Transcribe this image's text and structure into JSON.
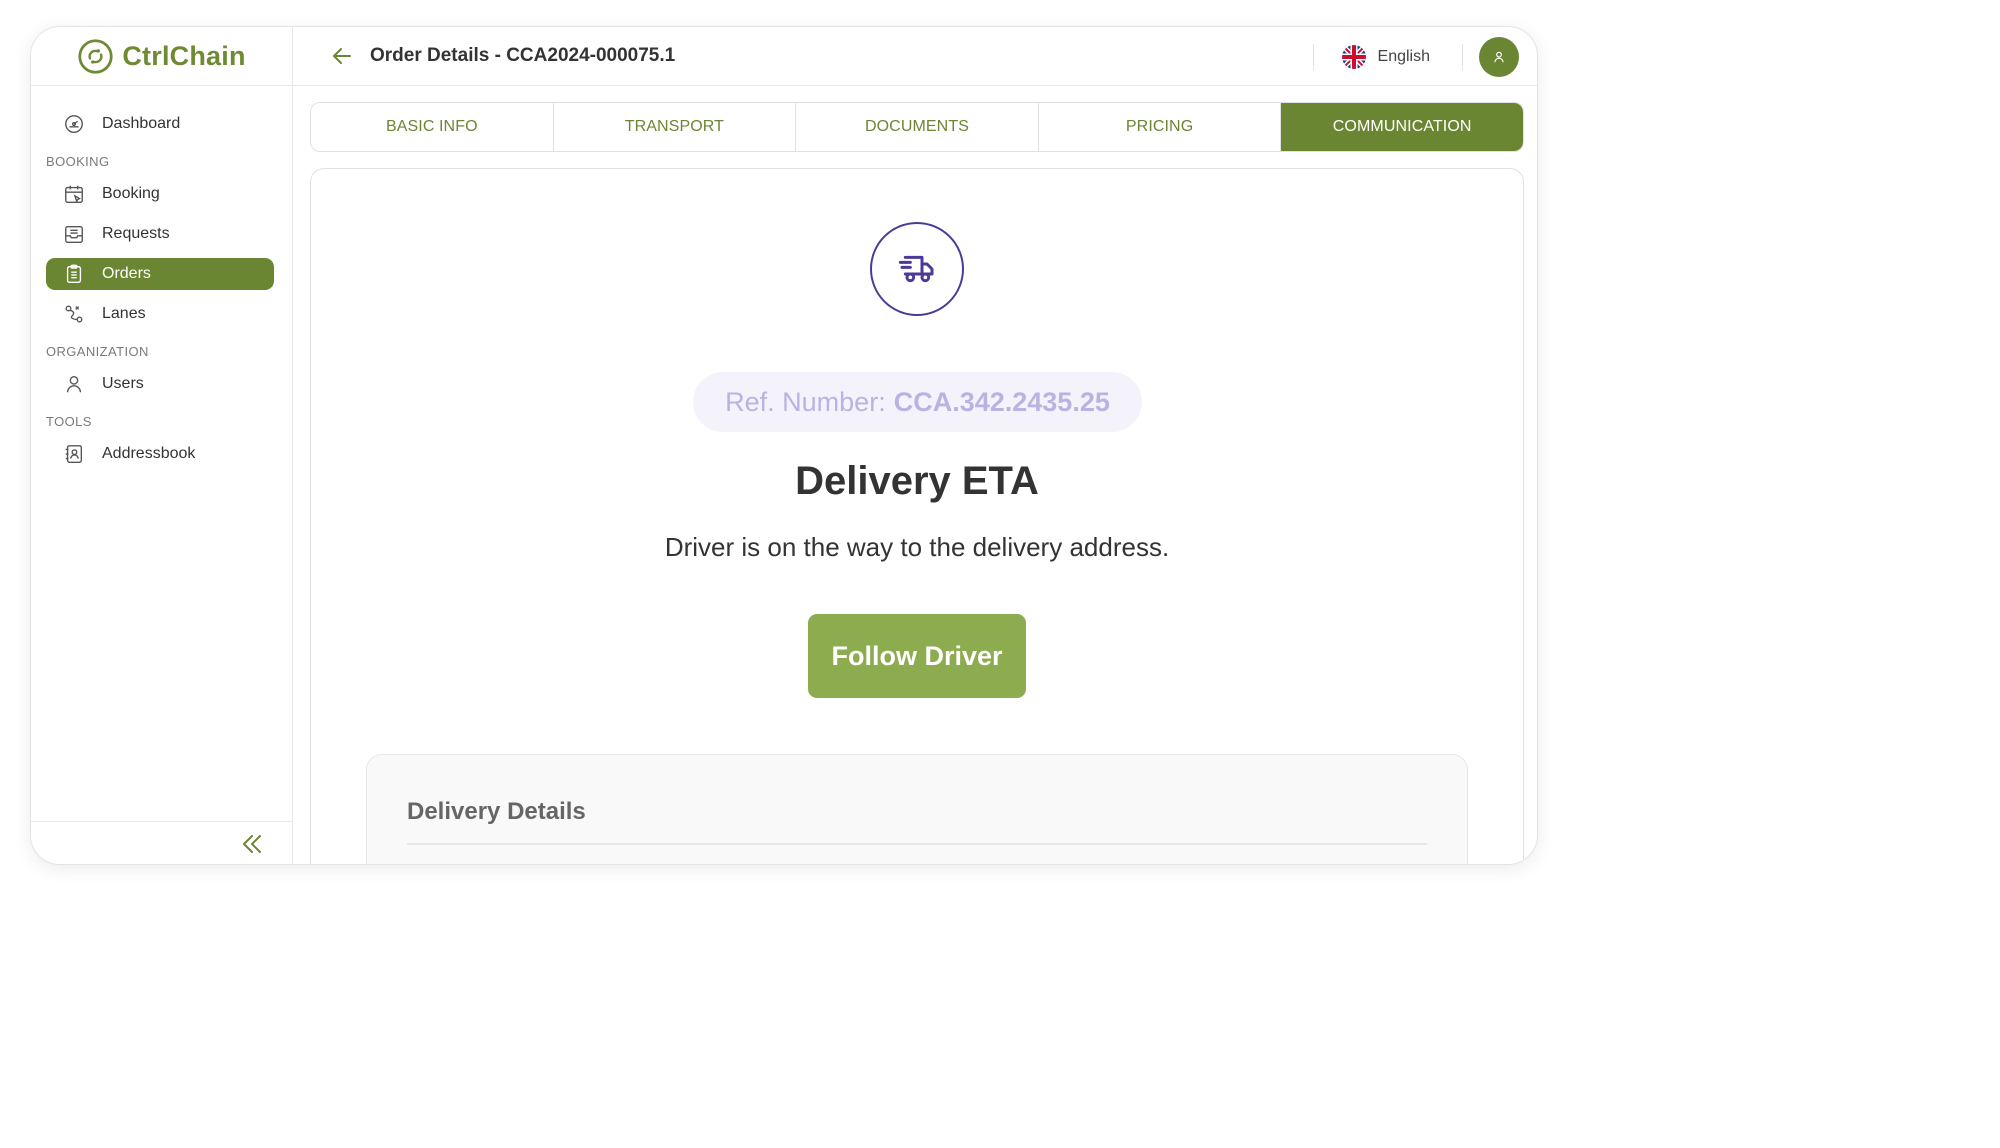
{
  "app": {
    "name": "CtrlChain",
    "brand_color": "#6b8633",
    "accent_color": "#4e3a96"
  },
  "sidebar": {
    "items_top": [
      {
        "label": "Dashboard",
        "icon": "dashboard-icon"
      }
    ],
    "sections": [
      {
        "title": "BOOKING",
        "items": [
          {
            "label": "Booking",
            "icon": "calendar-icon"
          },
          {
            "label": "Requests",
            "icon": "inbox-icon"
          },
          {
            "label": "Orders",
            "icon": "clipboard-icon",
            "active": true
          },
          {
            "label": "Lanes",
            "icon": "route-icon"
          }
        ]
      },
      {
        "title": "ORGANIZATION",
        "items": [
          {
            "label": "Users",
            "icon": "user-icon"
          }
        ]
      },
      {
        "title": "TOOLS",
        "items": [
          {
            "label": "Addressbook",
            "icon": "addressbook-icon"
          }
        ]
      }
    ]
  },
  "header": {
    "title": "Order Details - CCA2024-000075.1",
    "language": "English"
  },
  "tabs": [
    {
      "label": "BASIC INFO"
    },
    {
      "label": "TRANSPORT"
    },
    {
      "label": "DOCUMENTS"
    },
    {
      "label": "PRICING"
    },
    {
      "label": "COMMUNICATION",
      "active": true
    }
  ],
  "main": {
    "ref_label": "Ref. Number:",
    "ref_value": "CCA.342.2435.25",
    "eta_title": "Delivery ETA",
    "eta_subtitle": "Driver is on the way to the delivery address.",
    "follow_button": "Follow Driver",
    "details_title": "Delivery Details"
  }
}
